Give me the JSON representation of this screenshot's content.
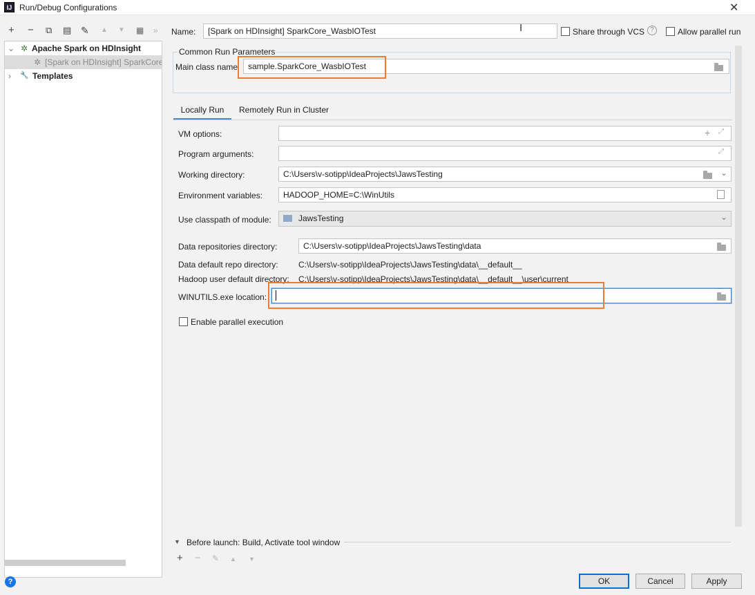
{
  "window": {
    "app_icon_text": "IJ",
    "title": "Run/Debug Configurations",
    "close_glyph": "✕"
  },
  "toolbar": {
    "add": "+",
    "remove": "−",
    "copy": "⧉",
    "save": "▤",
    "edit": "✎",
    "up": "▲",
    "down": "▼",
    "folder": "▦",
    "more": "»"
  },
  "tree": {
    "items": [
      {
        "arrow": "⌄",
        "icon": "✲",
        "label": "Apache Spark on HDInsight"
      },
      {
        "icon": "✲",
        "label": "[Spark on HDInsight] SparkCore_WasbIOTest"
      },
      {
        "arrow": "›",
        "icon": "🔧",
        "label": "Templates"
      }
    ]
  },
  "header": {
    "name_label": "Name:",
    "name_value": "[Spark on HDInsight] SparkCore_WasbIOTest",
    "share_label": "Share through VCS",
    "help_glyph": "?",
    "parallel_label": "Allow parallel run"
  },
  "common": {
    "title": "Common Run Parameters",
    "main_class_label": "Main class name",
    "main_class_value": "sample.SparkCore_WasbIOTest"
  },
  "tabs": [
    {
      "label": "Locally Run"
    },
    {
      "label": "Remotely Run in Cluster"
    }
  ],
  "form": {
    "vm_options_label": "VM options:",
    "vm_options_value": "",
    "program_args_label": "Program arguments:",
    "program_args_value": "",
    "working_dir_label": "Working directory:",
    "working_dir_value": "C:\\Users\\v-sotipp\\IdeaProjects\\JawsTesting",
    "env_label": "Environment variables:",
    "env_value": "HADOOP_HOME=C:\\WinUtils",
    "classpath_label": "Use classpath of module:",
    "classpath_value": "JawsTesting",
    "data_repo_label": "Data repositories directory:",
    "data_repo_value": "C:\\Users\\v-sotipp\\IdeaProjects\\JawsTesting\\data",
    "default_repo_label": "Data default repo directory:",
    "default_repo_value": "C:\\Users\\v-sotipp\\IdeaProjects\\JawsTesting\\data\\__default__",
    "hadoop_user_label": "Hadoop user default directory:",
    "hadoop_user_value": "C:\\Users\\v-sotipp\\IdeaProjects\\JawsTesting\\data\\__default__\\user\\current",
    "winutils_label": "WINUTILS.exe location:",
    "winutils_value": "",
    "parallel_exec_label": "Enable parallel execution"
  },
  "before_launch": {
    "arrow": "▼",
    "label": "Before launch: Build, Activate tool window",
    "add": "+",
    "remove": "−",
    "edit": "✎",
    "up": "▲",
    "down": "▼"
  },
  "buttons": {
    "ok": "OK",
    "cancel": "Cancel",
    "apply": "Apply"
  },
  "colors": {
    "highlight": "#ef7c2c",
    "accent": "#4a88c7",
    "help_blue": "#1b73e8"
  }
}
